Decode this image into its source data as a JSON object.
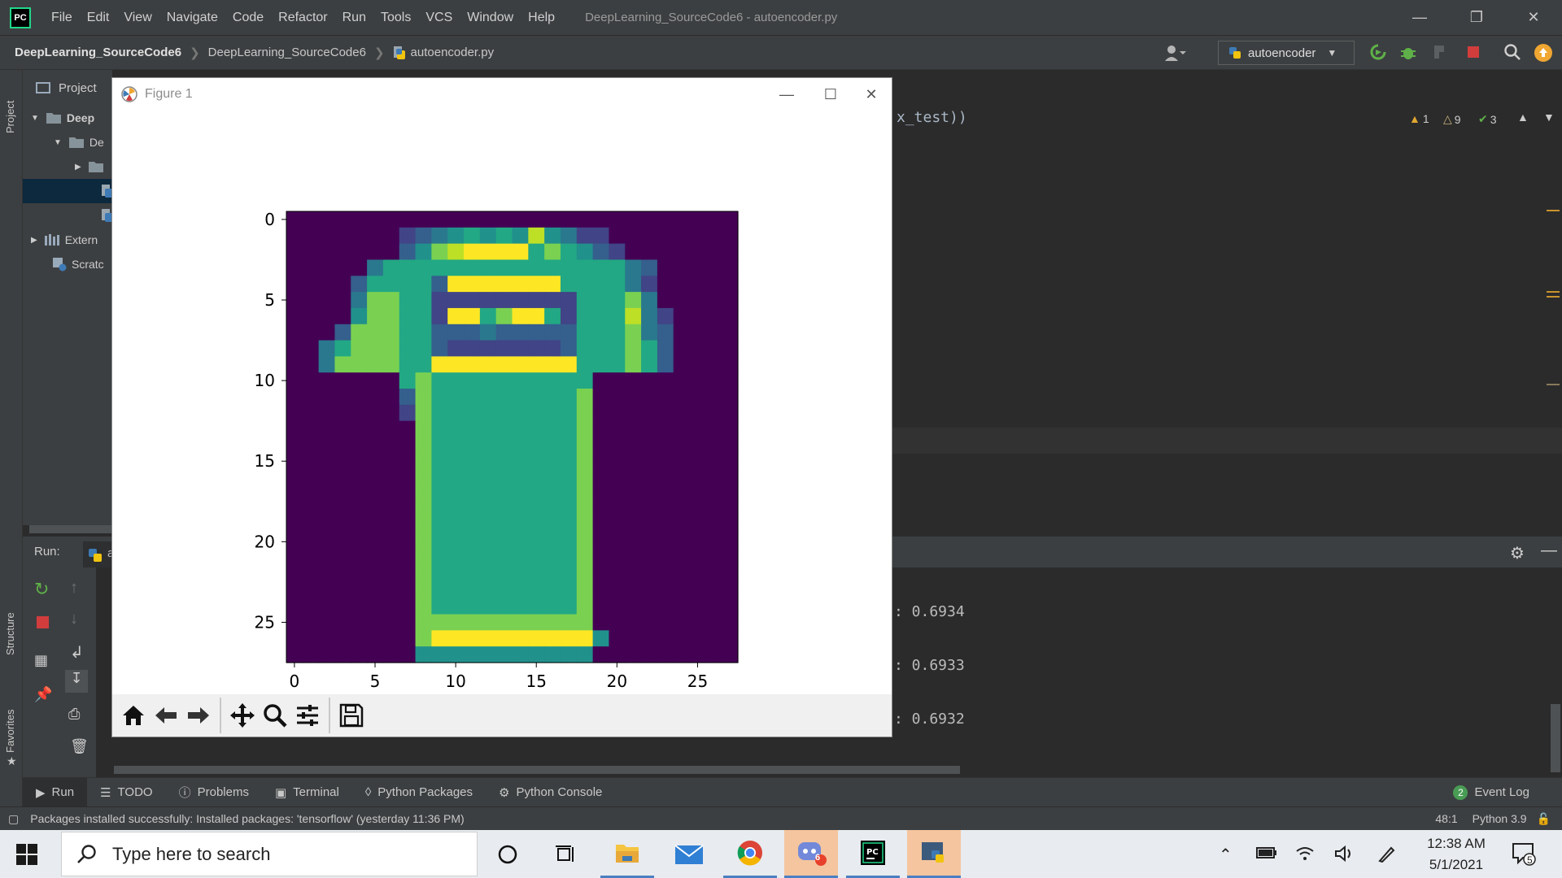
{
  "menubar": {
    "items": [
      "File",
      "Edit",
      "View",
      "Navigate",
      "Code",
      "Refactor",
      "Run",
      "Tools",
      "VCS",
      "Window",
      "Help"
    ],
    "window_title": "DeepLearning_SourceCode6 - autoencoder.py"
  },
  "navbar": {
    "project": "DeepLearning_SourceCode6",
    "folder": "DeepLearning_SourceCode6",
    "file": "autoencoder.py",
    "run_config": "autoencoder"
  },
  "project_panel": {
    "title": "Project",
    "tree": [
      "Deep",
      "De",
      "",
      "",
      "",
      "Extern",
      "Scratc"
    ]
  },
  "left_strip": {
    "project": "Project",
    "structure": "Structure",
    "favorites": "Favorites"
  },
  "editor": {
    "code_line": "x_test))",
    "inspections": {
      "warnings": "1",
      "weak_warnings": "9",
      "typos": "3"
    }
  },
  "run_panel": {
    "label": "Run:",
    "tab_fragment": "a",
    "outputs": [
      ": 0.6934",
      ": 0.6933",
      ": 0.6932"
    ]
  },
  "tool_tabs": [
    "Run",
    "TODO",
    "Problems",
    "Terminal",
    "Python Packages",
    "Python Console"
  ],
  "event_log": {
    "count": "2",
    "label": "Event Log"
  },
  "statusbar": {
    "message": "Packages installed successfully: Installed packages: 'tensorflow' (yesterday 11:36 PM)",
    "position": "48:1",
    "interpreter": "Python 3.9"
  },
  "figure": {
    "title": "Figure 1",
    "x_ticks": [
      "0",
      "5",
      "10",
      "15",
      "20",
      "25"
    ],
    "y_ticks": [
      "0",
      "5",
      "10",
      "15",
      "20",
      "25"
    ]
  },
  "chart_data": {
    "type": "heatmap",
    "title": "",
    "xlabel": "",
    "ylabel": "",
    "x_ticks": [
      0,
      5,
      10,
      15,
      20,
      25
    ],
    "y_ticks": [
      0,
      5,
      10,
      15,
      20,
      25
    ],
    "shape": [
      28,
      28
    ],
    "colormap": "viridis",
    "x_range": [
      -0.5,
      27.5
    ],
    "y_range": [
      27.5,
      -0.5
    ],
    "rows": [
      "0000000000000000000000000000",
      "0000000234565658542200000000",
      "0000000357899996765320000000",
      "0000046666666666666664300000",
      "0000366663999999966664200000",
      "0000477662222222226667400000",
      "0000577662996799626668420000",
      "0003777663334333336667430000",
      "0046777663222222236667630000",
      "0047777669999999996667630000",
      "0000000676666666666000000000",
      "0000000376666666667000000000",
      "0000000276666666667000000000",
      "0000000076666666667000000000",
      "0000000076666666667000000000",
      "0000000076666666667000000000",
      "0000000076666666667000000000",
      "0000000076666666667000000000",
      "0000000076666666667000000000",
      "0000000076666666667000000000",
      "0000000076666666667000000000",
      "0000000076666666667000000000",
      "0000000076666666667000000000",
      "0000000076666666667000000000",
      "0000000076666666667000000000",
      "0000000077777777777000000000",
      "0000000079999999999500000000",
      "0000000055555555555000000000"
    ]
  },
  "figure_toolbar": [
    "home-icon",
    "back-icon",
    "forward-icon",
    "pan-icon",
    "zoom-icon",
    "configure-subplots-icon",
    "save-icon"
  ],
  "taskbar": {
    "search_placeholder": "Type here to search",
    "time": "12:38 AM",
    "date": "5/1/2021",
    "notification_count": "5",
    "discord_badge": "6"
  }
}
